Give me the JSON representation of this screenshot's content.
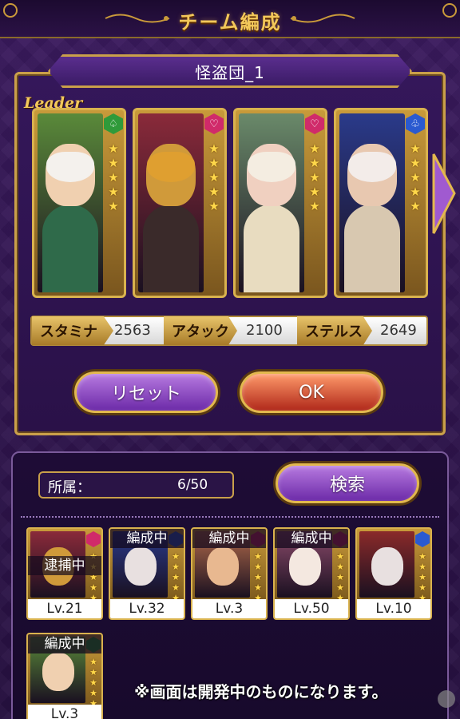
{
  "header": {
    "title": "チーム編成"
  },
  "team": {
    "name": "怪盗団_1",
    "leader_label": "Leader",
    "cards": [
      {
        "attr_color": "#2f9a3a",
        "attr_glyph": "♤",
        "stars": 5,
        "palette": {
          "bg": "#5a8a3a",
          "face": "#f0d0b0",
          "body": "#2f6a4a",
          "mask": "#f4f4f4"
        }
      },
      {
        "attr_color": "#d02a6a",
        "attr_glyph": "♡",
        "stars": 5,
        "palette": {
          "bg": "#8a2a3a",
          "face": "#d09a3a",
          "body": "#3a2a2a",
          "mask": "#e0a030"
        }
      },
      {
        "attr_color": "#d02a6a",
        "attr_glyph": "♡",
        "stars": 5,
        "palette": {
          "bg": "#6a8a6a",
          "face": "#f0d0c0",
          "body": "#e8dcc0",
          "mask": "#f4f0e4"
        }
      },
      {
        "attr_color": "#2a5ad0",
        "attr_glyph": "♧",
        "stars": 5,
        "palette": {
          "bg": "#2a3a8a",
          "face": "#e8c8b0",
          "body": "#d8c8b0",
          "mask": "#f4f0f0"
        }
      }
    ],
    "stats": [
      {
        "label": "スタミナ",
        "value": "2563"
      },
      {
        "label": "アタック",
        "value": "2100"
      },
      {
        "label": "ステルス",
        "value": "2649"
      }
    ],
    "reset_label": "リセット",
    "ok_label": "OK"
  },
  "roster": {
    "affiliation_label": "所属：",
    "affiliation_value": "6/50",
    "search_label": "検索",
    "items": [
      {
        "level": "Lv.21",
        "status": "逮捕中",
        "status_pos": "mid",
        "badge": "#d02a6a",
        "palette": {
          "bg": "#8a2a3a",
          "face": "#d09a3a"
        }
      },
      {
        "level": "Lv.32",
        "status": "編成中",
        "status_pos": "top",
        "badge": "#2a5ad0",
        "palette": {
          "bg": "#2a3a8a",
          "face": "#e8e0e0"
        }
      },
      {
        "level": "Lv.3",
        "status": "編成中",
        "status_pos": "top",
        "badge": "#d02a6a",
        "palette": {
          "bg": "#b06a4a",
          "face": "#e8b890"
        }
      },
      {
        "level": "Lv.50",
        "status": "編成中",
        "status_pos": "top",
        "badge": "#d02a6a",
        "palette": {
          "bg": "#8a4a6a",
          "face": "#f4e8e0"
        }
      },
      {
        "level": "Lv.10",
        "status": "",
        "status_pos": "top",
        "badge": "#2a5ad0",
        "palette": {
          "bg": "#8a2a2a",
          "face": "#e8e0e0"
        }
      },
      {
        "level": "Lv.3",
        "status": "編成中",
        "status_pos": "top",
        "badge": "#2f9a3a",
        "palette": {
          "bg": "#5a8a3a",
          "face": "#f0d0b0"
        }
      }
    ]
  },
  "footnote": "※画面は開発中のものになります。",
  "colors": {
    "gold": "#caa04a",
    "purple_dark": "#2a1245"
  }
}
